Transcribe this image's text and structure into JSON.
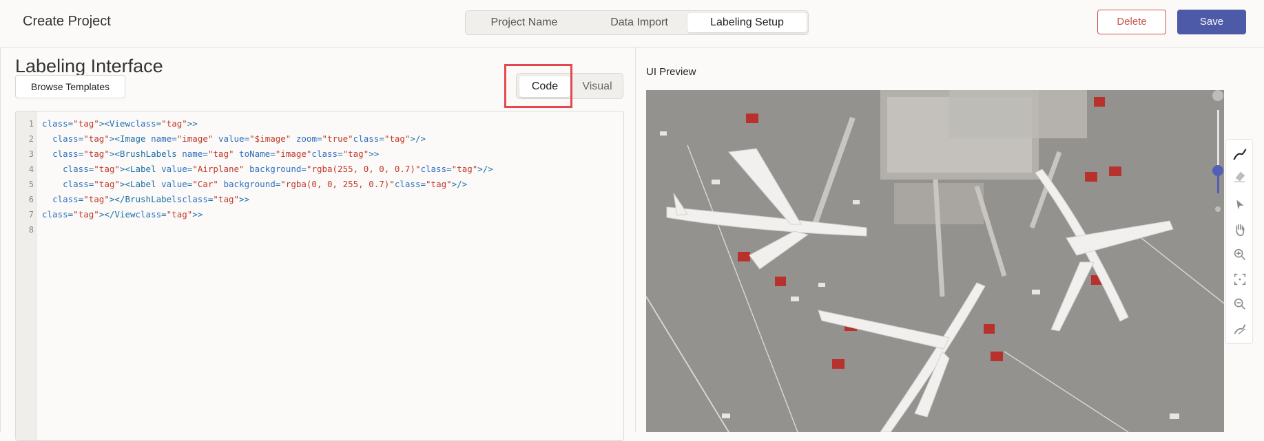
{
  "header": {
    "title": "Create Project",
    "tabs": [
      {
        "label": "Project Name"
      },
      {
        "label": "Data Import"
      },
      {
        "label": "Labeling Setup",
        "active": true
      }
    ],
    "delete_label": "Delete",
    "save_label": "Save"
  },
  "config": {
    "title": "Labeling Interface",
    "browse_label": "Browse Templates",
    "mode_toggle": {
      "code": "Code",
      "visual": "Visual",
      "selected": "Code"
    },
    "code_lines": [
      "<View>",
      "  <Image name=\"image\" value=\"$image\" zoom=\"true\"/>",
      "  <BrushLabels name=\"tag\" toName=\"image\">",
      "    <Label value=\"Airplane\" background=\"rgba(255, 0, 0, 0.7)\"/>",
      "    <Label value=\"Car\" background=\"rgba(0, 0, 255, 0.7)\"/>",
      "  </BrushLabels>",
      "</View>",
      ""
    ],
    "line_numbers": [
      "1",
      "2",
      "3",
      "4",
      "5",
      "6",
      "7",
      "8"
    ]
  },
  "preview": {
    "title": "UI Preview",
    "zoom_level": 0.25,
    "tools": [
      "brush-icon",
      "eraser-icon",
      "pointer-icon",
      "hand-icon",
      "zoom-in-icon",
      "fit-icon",
      "zoom-out-icon",
      "magic-brush-icon"
    ]
  },
  "colors": {
    "accent": "#4c5aa8",
    "danger": "#c8554a",
    "highlight": "#e5474f"
  }
}
